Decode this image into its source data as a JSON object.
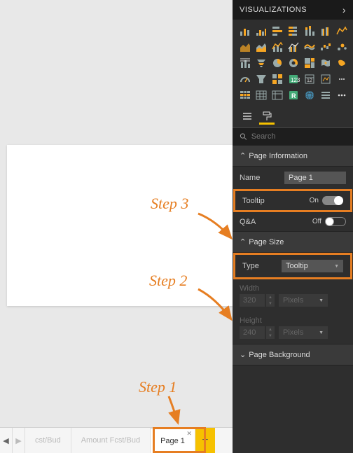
{
  "panel": {
    "title": "VISUALIZATIONS",
    "search_placeholder": "Search",
    "viz_icons": [
      "stacked-area",
      "stacked-bar",
      "clustered-bar",
      "stacked-column",
      "clustered-column",
      "line",
      "area",
      "line-stacked",
      "line-clustered",
      "ribbon",
      "waterfall",
      "scatter",
      "combo1",
      "combo2",
      "funnel-h",
      "treemap",
      "pie",
      "donut",
      "map",
      "filled-map",
      "gauge",
      "card",
      "multi-card",
      "kpi",
      "slicer",
      "matrix",
      "table",
      "shape",
      "funnel",
      "filter",
      "python",
      "r-script",
      "globe",
      "more-h",
      "more"
    ],
    "sections": {
      "page_info": {
        "title": "Page Information",
        "name_label": "Name",
        "name_value": "Page 1",
        "tooltip_label": "Tooltip",
        "tooltip_state": "On",
        "qa_label": "Q&A",
        "qa_state": "Off"
      },
      "page_size": {
        "title": "Page Size",
        "type_label": "Type",
        "type_value": "Tooltip",
        "width_label": "Width",
        "width_value": "320",
        "width_unit": "Pixels",
        "height_label": "Height",
        "height_value": "240",
        "height_unit": "Pixels"
      },
      "page_bg": {
        "title": "Page Background"
      }
    }
  },
  "tabs": {
    "items": [
      {
        "label": "cst/Bud"
      },
      {
        "label": "Amount Fcst/Bud"
      },
      {
        "label": "Page 1"
      }
    ],
    "add": "+"
  },
  "annotations": {
    "step1": "Step 1",
    "step2": "Step 2",
    "step3": "Step 3"
  }
}
